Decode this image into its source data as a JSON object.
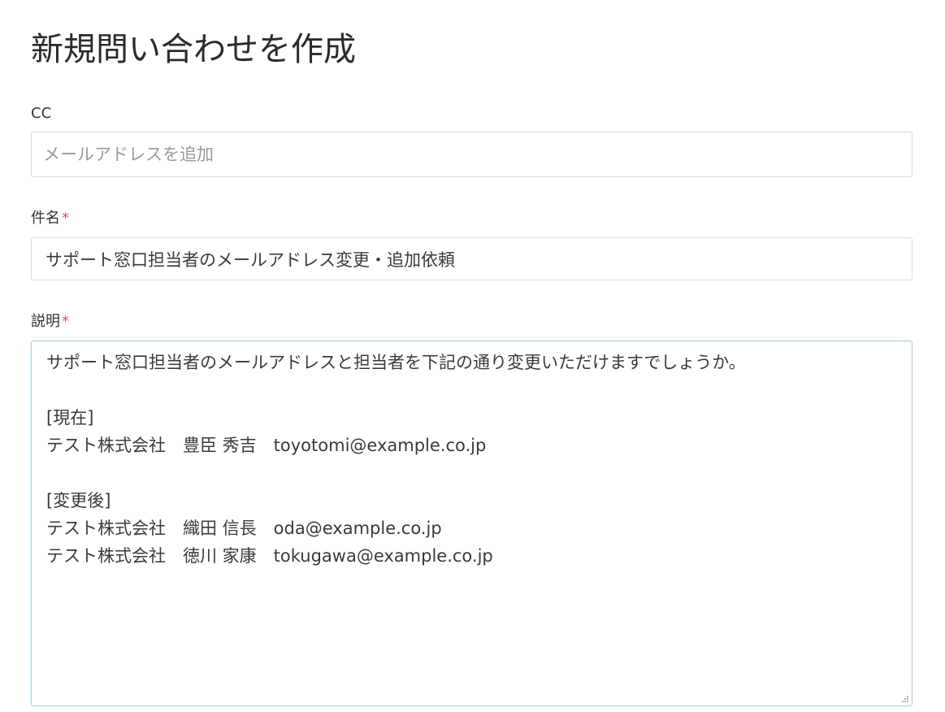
{
  "page": {
    "title": "新規問い合わせを作成"
  },
  "form": {
    "cc": {
      "label": "CC",
      "placeholder": "メールアドレスを追加",
      "value": ""
    },
    "subject": {
      "label": "件名",
      "required_mark": "*",
      "value": "サポート窓口担当者のメールアドレス変更・追加依頼"
    },
    "description": {
      "label": "説明",
      "required_mark": "*",
      "lines": [
        "サポート窓口担当者のメールアドレスと担当者を下記の通り変更いただけますでしょうか。",
        "",
        "[現在]",
        "テスト株式会社　豊臣 秀吉　toyotomi@example.co.jp",
        "",
        "[変更後]",
        "テスト株式会社　織田 信長　oda@example.co.jp",
        "テスト株式会社　徳川 家康　tokugawa@example.co.jp"
      ]
    }
  },
  "colors": {
    "required": "#e0525e",
    "focus_border": "#9ecde4",
    "input_border": "#d9d9d9",
    "placeholder": "#9a9a9a"
  },
  "icons": {
    "resize_handle": "resize-grip-icon"
  }
}
